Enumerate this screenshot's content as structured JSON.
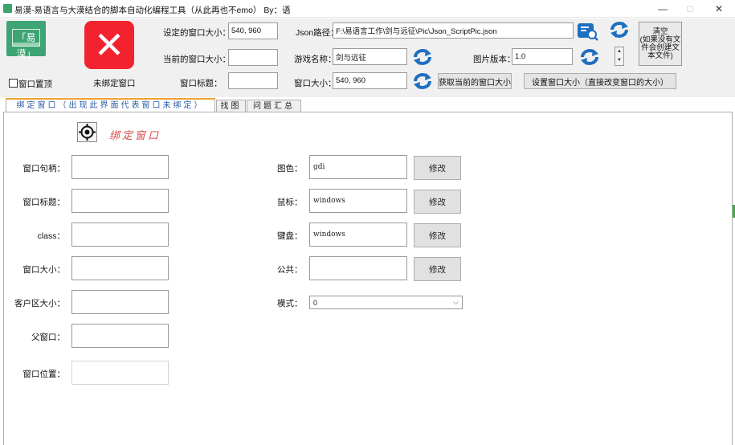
{
  "window": {
    "title": "易漠-易语言与大漠结合的脚本自动化编程工具（从此再也不emo）   By：语",
    "minimize": "—",
    "maximize": "□",
    "close": "✕"
  },
  "header": {
    "logo_text": "「易漠」",
    "pin_label": "窗口置顶",
    "bind_status": "未绑定窗口",
    "set_size_label": "设定的窗口大小：",
    "set_size_value": "540, 960",
    "current_size_label": "当前的窗口大小：",
    "current_size_value": "",
    "window_title_label": "窗口标题：",
    "window_title_value": "",
    "json_path_label": "Json路径：",
    "json_path_value": "F:\\易语言工作\\剑与远征\\Pic\\Json_ScriptPic.json",
    "game_name_label": "游戏名称：",
    "game_name_value": "剑与远征",
    "pic_version_label": "图片版本：",
    "pic_version_value": "1.0",
    "window_size_label": "窗口大小：",
    "window_size_value": "540, 960",
    "get_size_button": "获取当前的窗口大小",
    "set_size_button": "设置窗口大小（直接改变窗口的大小）",
    "clear_button_line1": "清空",
    "clear_button_line2": "(如果没有文",
    "clear_button_line3": "件会创建文",
    "clear_button_line4": "本文件)"
  },
  "tabs": [
    {
      "label": "绑定窗口（出现此界面代表窗口未绑定）"
    },
    {
      "label": "找图"
    },
    {
      "label": "问题汇总"
    }
  ],
  "bind_panel": {
    "bind_window_text": "绑定窗口",
    "fields": [
      {
        "label": "窗口句柄："
      },
      {
        "label": "窗口标题："
      },
      {
        "label": "class："
      },
      {
        "label": "窗口大小："
      },
      {
        "label": "客户区大小："
      },
      {
        "label": "父窗口："
      },
      {
        "label": "窗口位置："
      }
    ],
    "modes": [
      {
        "label": "图色：",
        "value": "gdi",
        "button": "修改"
      },
      {
        "label": "鼠标：",
        "value": "windows",
        "button": "修改"
      },
      {
        "label": "键盘：",
        "value": "windows",
        "button": "修改"
      },
      {
        "label": "公共：",
        "value": "",
        "button": "修改"
      }
    ],
    "mode_label": "模式：",
    "mode_value": "0"
  },
  "colors": {
    "accent_green": "#3ea473",
    "danger_red": "#f2232f",
    "refresh_blue": "#1e6fc0",
    "tab_active": "#2b5ba8",
    "bind_text": "#d84848"
  }
}
